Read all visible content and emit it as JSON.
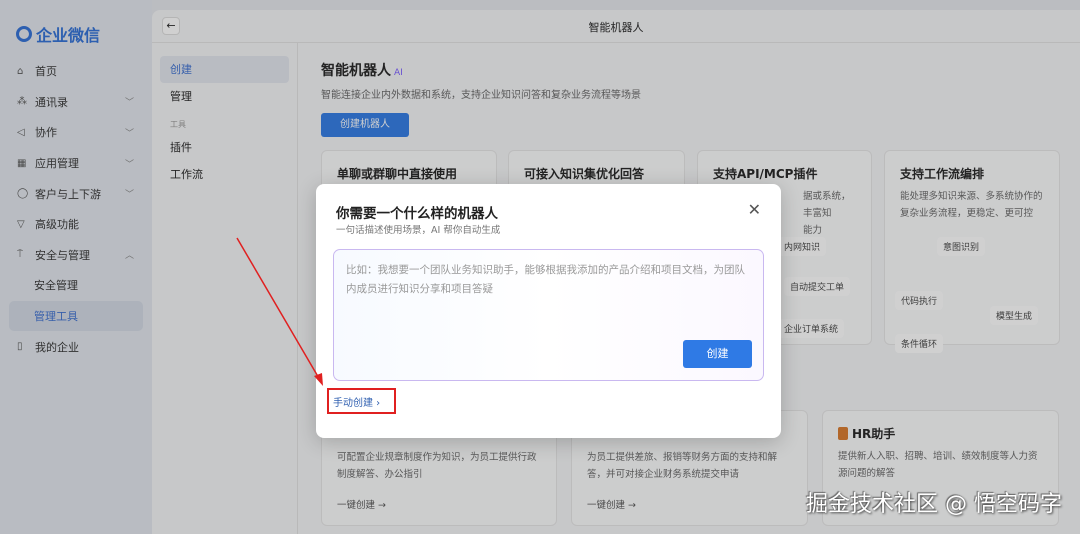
{
  "logo": "企业微信",
  "sidebar": {
    "items": [
      {
        "label": "首页",
        "icon": "home-icon"
      },
      {
        "label": "通讯录",
        "icon": "contacts-icon"
      },
      {
        "label": "协作",
        "icon": "collab-icon"
      },
      {
        "label": "应用管理",
        "icon": "apps-icon"
      },
      {
        "label": "客户与上下游",
        "icon": "chat-icon"
      },
      {
        "label": "高级功能",
        "icon": "advanced-icon"
      },
      {
        "label": "安全与管理",
        "icon": "shield-icon"
      },
      {
        "label": "安全管理"
      },
      {
        "label": "管理工具"
      },
      {
        "label": "我的企业",
        "icon": "company-icon"
      }
    ]
  },
  "header": {
    "title": "智能机器人"
  },
  "subnav": {
    "create": "创建",
    "manage": "管理",
    "group": "工具",
    "plugin": "插件",
    "workflow": "工作流"
  },
  "content": {
    "title": "智能机器人",
    "ai": "AI",
    "desc": "智能连接企业内外数据和系统，支持企业知识问答和复杂业务流程等场景",
    "create_button": "创建机器人",
    "features": [
      {
        "title": "单聊或群聊中直接使用"
      },
      {
        "title": "可接入知识集优化回答"
      },
      {
        "title": "支持API/MCP插件",
        "desc": "据或系统，丰富知",
        "desc2": "能力",
        "chips": [
          "内网知识",
          "自动提交工单",
          "企业订单系统"
        ]
      },
      {
        "title": "支持工作流编排",
        "desc": "能处理多知识来源、多系统协作的复杂业务流程，更稳定、更可控",
        "chips": [
          "意图识别",
          "代码执行",
          "模型生成",
          "条件循环"
        ]
      }
    ],
    "templates": [
      {
        "desc": "可配置企业规章制度作为知识，为员工提供行政制度解答、办公指引",
        "action": "一键创建 →"
      },
      {
        "desc": "为员工提供差旅、报销等财务方面的支持和解答，并可对接企业财务系统提交申请",
        "action": "一键创建 →"
      },
      {
        "title": "HR助手",
        "desc": "提供新人入职、招聘、培训、绩效制度等人力资源问题的解答"
      }
    ]
  },
  "modal": {
    "title": "你需要一个什么样的机器人",
    "subtitle": "一句话描述使用场景，AI 帮你自动生成",
    "placeholder": "比如：我想要一个团队业务知识助手，能够根据我添加的产品介绍和项目文档，为团队内成员进行知识分享和项目答疑",
    "create": "创建",
    "manual": "手动创建 ›"
  },
  "watermark": "掘金技术社区 @ 悟空码字"
}
